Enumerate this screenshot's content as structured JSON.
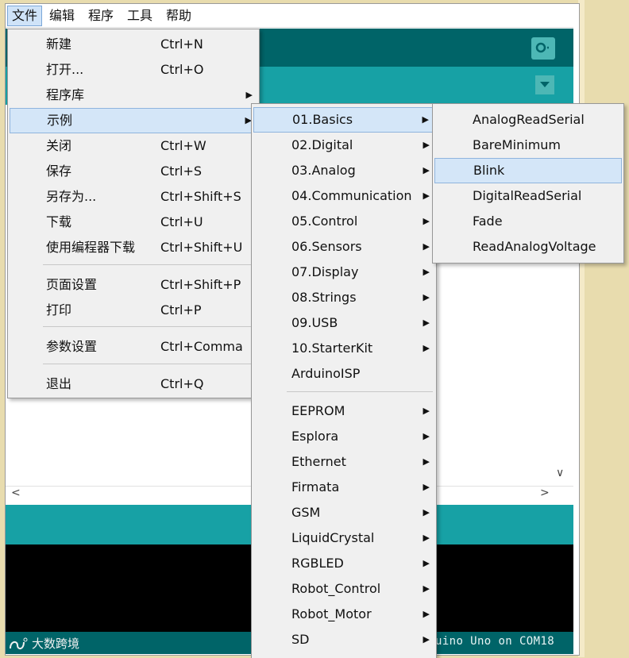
{
  "menubar": {
    "items": [
      "文件",
      "编辑",
      "程序",
      "工具",
      "帮助"
    ]
  },
  "file_menu": {
    "items": [
      {
        "label": "新建",
        "shortcut": "Ctrl+N"
      },
      {
        "label": "打开...",
        "shortcut": "Ctrl+O"
      },
      {
        "label": "程序库",
        "shortcut": ""
      },
      {
        "label": "示例",
        "shortcut": ""
      },
      {
        "label": "关闭",
        "shortcut": "Ctrl+W"
      },
      {
        "label": "保存",
        "shortcut": "Ctrl+S"
      },
      {
        "label": "另存为...",
        "shortcut": "Ctrl+Shift+S"
      },
      {
        "label": "下载",
        "shortcut": "Ctrl+U"
      },
      {
        "label": "使用编程器下载",
        "shortcut": "Ctrl+Shift+U"
      },
      {
        "label": "页面设置",
        "shortcut": "Ctrl+Shift+P"
      },
      {
        "label": "打印",
        "shortcut": "Ctrl+P"
      },
      {
        "label": "参数设置",
        "shortcut": "Ctrl+Comma"
      },
      {
        "label": "退出",
        "shortcut": "Ctrl+Q"
      }
    ]
  },
  "examples_menu": {
    "items": [
      "01.Basics",
      "02.Digital",
      "03.Analog",
      "04.Communication",
      "05.Control",
      "06.Sensors",
      "07.Display",
      "08.Strings",
      "09.USB",
      "10.StarterKit",
      "ArduinoISP",
      "EEPROM",
      "Esplora",
      "Ethernet",
      "Firmata",
      "GSM",
      "LiquidCrystal",
      "RGBLED",
      "Robot_Control",
      "Robot_Motor",
      "SD"
    ]
  },
  "basics_menu": {
    "items": [
      "AnalogReadSerial",
      "BareMinimum",
      "Blink",
      "DigitalReadSerial",
      "Fade",
      "ReadAnalogVoltage"
    ]
  },
  "status": {
    "board": "uino Uno on COM18"
  },
  "watermark": {
    "text": "大数跨境"
  },
  "colors": {
    "toolbar": "#006468",
    "tabs": "#17a1a5",
    "highlight": "#d4e6f8"
  }
}
